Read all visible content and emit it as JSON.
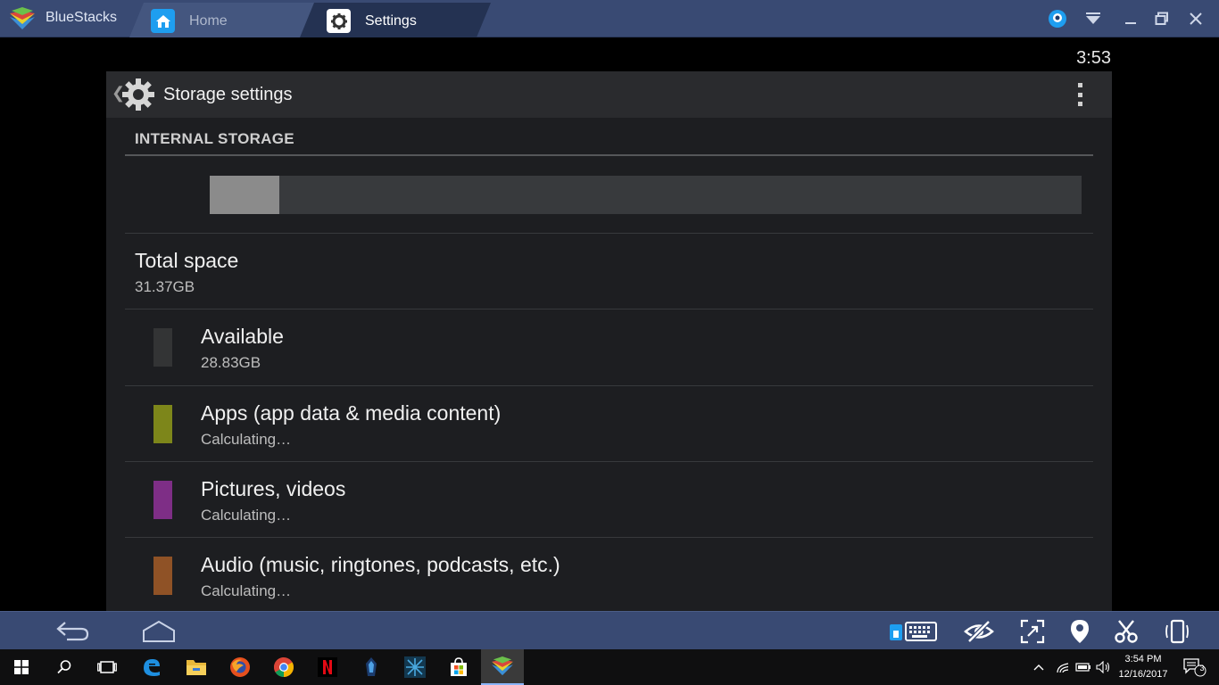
{
  "titlebar": {
    "app_name": "BlueStacks",
    "tabs": [
      {
        "label": "Home",
        "icon": "home-icon",
        "active": false
      },
      {
        "label": "Settings",
        "icon": "gear-icon",
        "active": true
      }
    ],
    "controls": [
      "account-icon",
      "dropdown-icon",
      "minimize-icon",
      "restore-icon",
      "close-icon"
    ]
  },
  "android": {
    "status_time": "3:53",
    "actionbar": {
      "title": "Storage settings",
      "icon": "gear-icon"
    },
    "section_header": "INTERNAL STORAGE",
    "usage_fraction": 0.08,
    "total": {
      "label": "Total space",
      "value": "31.37GB"
    },
    "items": [
      {
        "label": "Available",
        "value": "28.83GB",
        "color": "#333435"
      },
      {
        "label": "Apps (app data & media content)",
        "value": "Calculating…",
        "color": "#7d861a"
      },
      {
        "label": "Pictures, videos",
        "value": "Calculating…",
        "color": "#7e2e86"
      },
      {
        "label": "Audio (music, ringtones, podcasts, etc.)",
        "value": "Calculating…",
        "color": "#8f5226"
      }
    ]
  },
  "bottombar": {
    "left": [
      "back-arrow-icon",
      "home-outline-icon"
    ],
    "right": [
      "keyboard-icon",
      "hide-icon",
      "fullscreen-icon",
      "location-icon",
      "scissors-icon",
      "rotate-device-icon"
    ]
  },
  "taskbar": {
    "apps": [
      "windows-start-icon",
      "search-icon",
      "task-view-icon",
      "edge-icon",
      "file-explorer-icon",
      "firefox-icon",
      "chrome-icon",
      "netflix-icon",
      "app-icon",
      "app-icon-2",
      "store-icon",
      "bluestacks-icon"
    ],
    "time": "3:54 PM",
    "date": "12/16/2017",
    "notification_count": "3"
  },
  "colors": {
    "titlebar": "#394a73",
    "android_bg": "#1d1e21",
    "accent_blue": "#1e9ef0"
  }
}
